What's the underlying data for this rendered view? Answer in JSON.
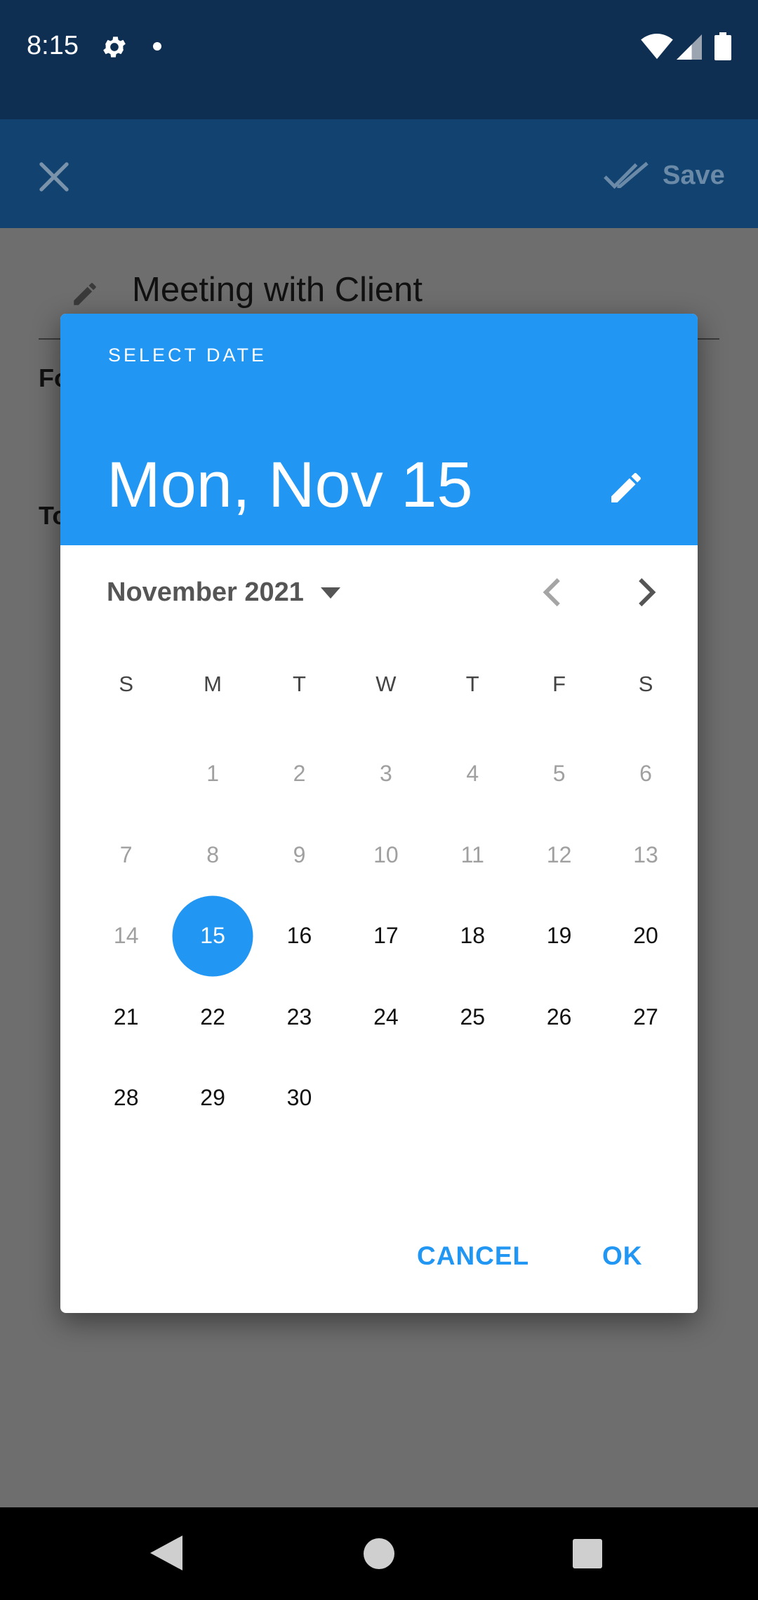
{
  "status_bar": {
    "time": "8:15",
    "icons": [
      "gear-icon",
      "notification-dot",
      "wifi-icon",
      "signal-icon",
      "battery-icon"
    ]
  },
  "app_bar": {
    "close_icon": "close-icon",
    "save_label": "Save",
    "save_icon": "double-check-icon"
  },
  "form": {
    "title_value": "Meeting with Client",
    "from_label": "Fo",
    "to_label": "To"
  },
  "date_picker": {
    "header_label": "SELECT DATE",
    "selected_date": "Mon, Nov 15",
    "month_year": "November 2021",
    "weekdays": [
      "S",
      "M",
      "T",
      "W",
      "T",
      "F",
      "S"
    ],
    "weeks": [
      [
        "",
        "1",
        "2",
        "3",
        "4",
        "5",
        "6"
      ],
      [
        "7",
        "8",
        "9",
        "10",
        "11",
        "12",
        "13"
      ],
      [
        "14",
        "15",
        "16",
        "17",
        "18",
        "19",
        "20"
      ],
      [
        "21",
        "22",
        "23",
        "24",
        "25",
        "26",
        "27"
      ],
      [
        "28",
        "29",
        "30",
        "",
        "",
        "",
        ""
      ]
    ],
    "selected_day": "15",
    "cancel_label": "CANCEL",
    "ok_label": "OK"
  },
  "colors": {
    "accent": "#2196f3",
    "status_bar": "#0e2f52",
    "app_bar_dimmed": "#12426f",
    "scrim": "#6e6e6e"
  }
}
